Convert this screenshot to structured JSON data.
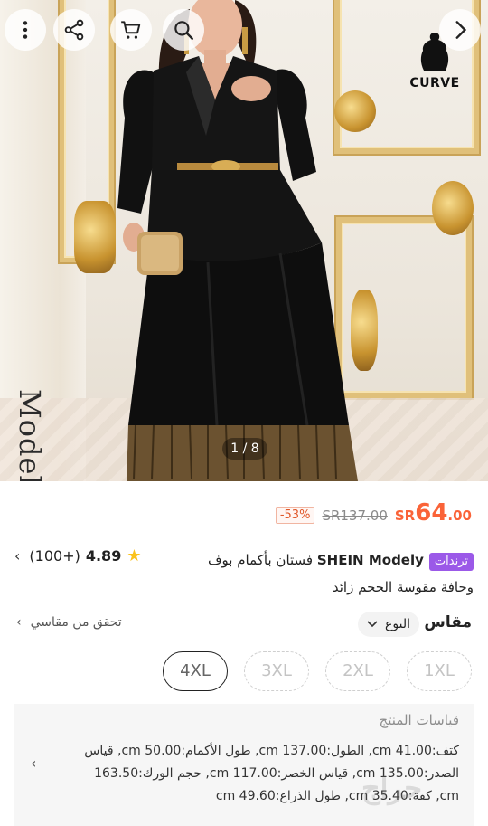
{
  "image": {
    "counter": "1 / 8",
    "brand_watermark": "Modely",
    "curve_badge": "CURVE"
  },
  "price": {
    "currency_prefix": "SR",
    "new_price_int": "64",
    "new_price_dec": ".00",
    "old_price": "SR137.00",
    "discount": "-53%",
    "accent_color": "#fa6338"
  },
  "product": {
    "trend_tag": "ترندات",
    "brand": "SHEIN Modely",
    "title_rest": "فستان بأكمام بوف وحافة مقوسة الحجم زائد",
    "rating_score": "4.89",
    "rating_count": "(100+)",
    "tag_color": "#9b59e8"
  },
  "size": {
    "title": "مقاس",
    "type_label": "النوع",
    "check_link": "تحقق من مقاسي",
    "options": [
      "1XL",
      "2XL",
      "3XL",
      "4XL"
    ],
    "selected": "4XL"
  },
  "measurements": {
    "title": "قياسات المنتج",
    "text": "كتف:41.00 cm, الطول:137.00 cm, طول الأكمام:50.00 cm, قياس الصدر:135.00 cm, قياس الخصر:117.00 cm, حجم الورك:163.50 cm, كفة:35.40 cm, طول الذراع:49.60 cm"
  },
  "watermark": "حراج"
}
